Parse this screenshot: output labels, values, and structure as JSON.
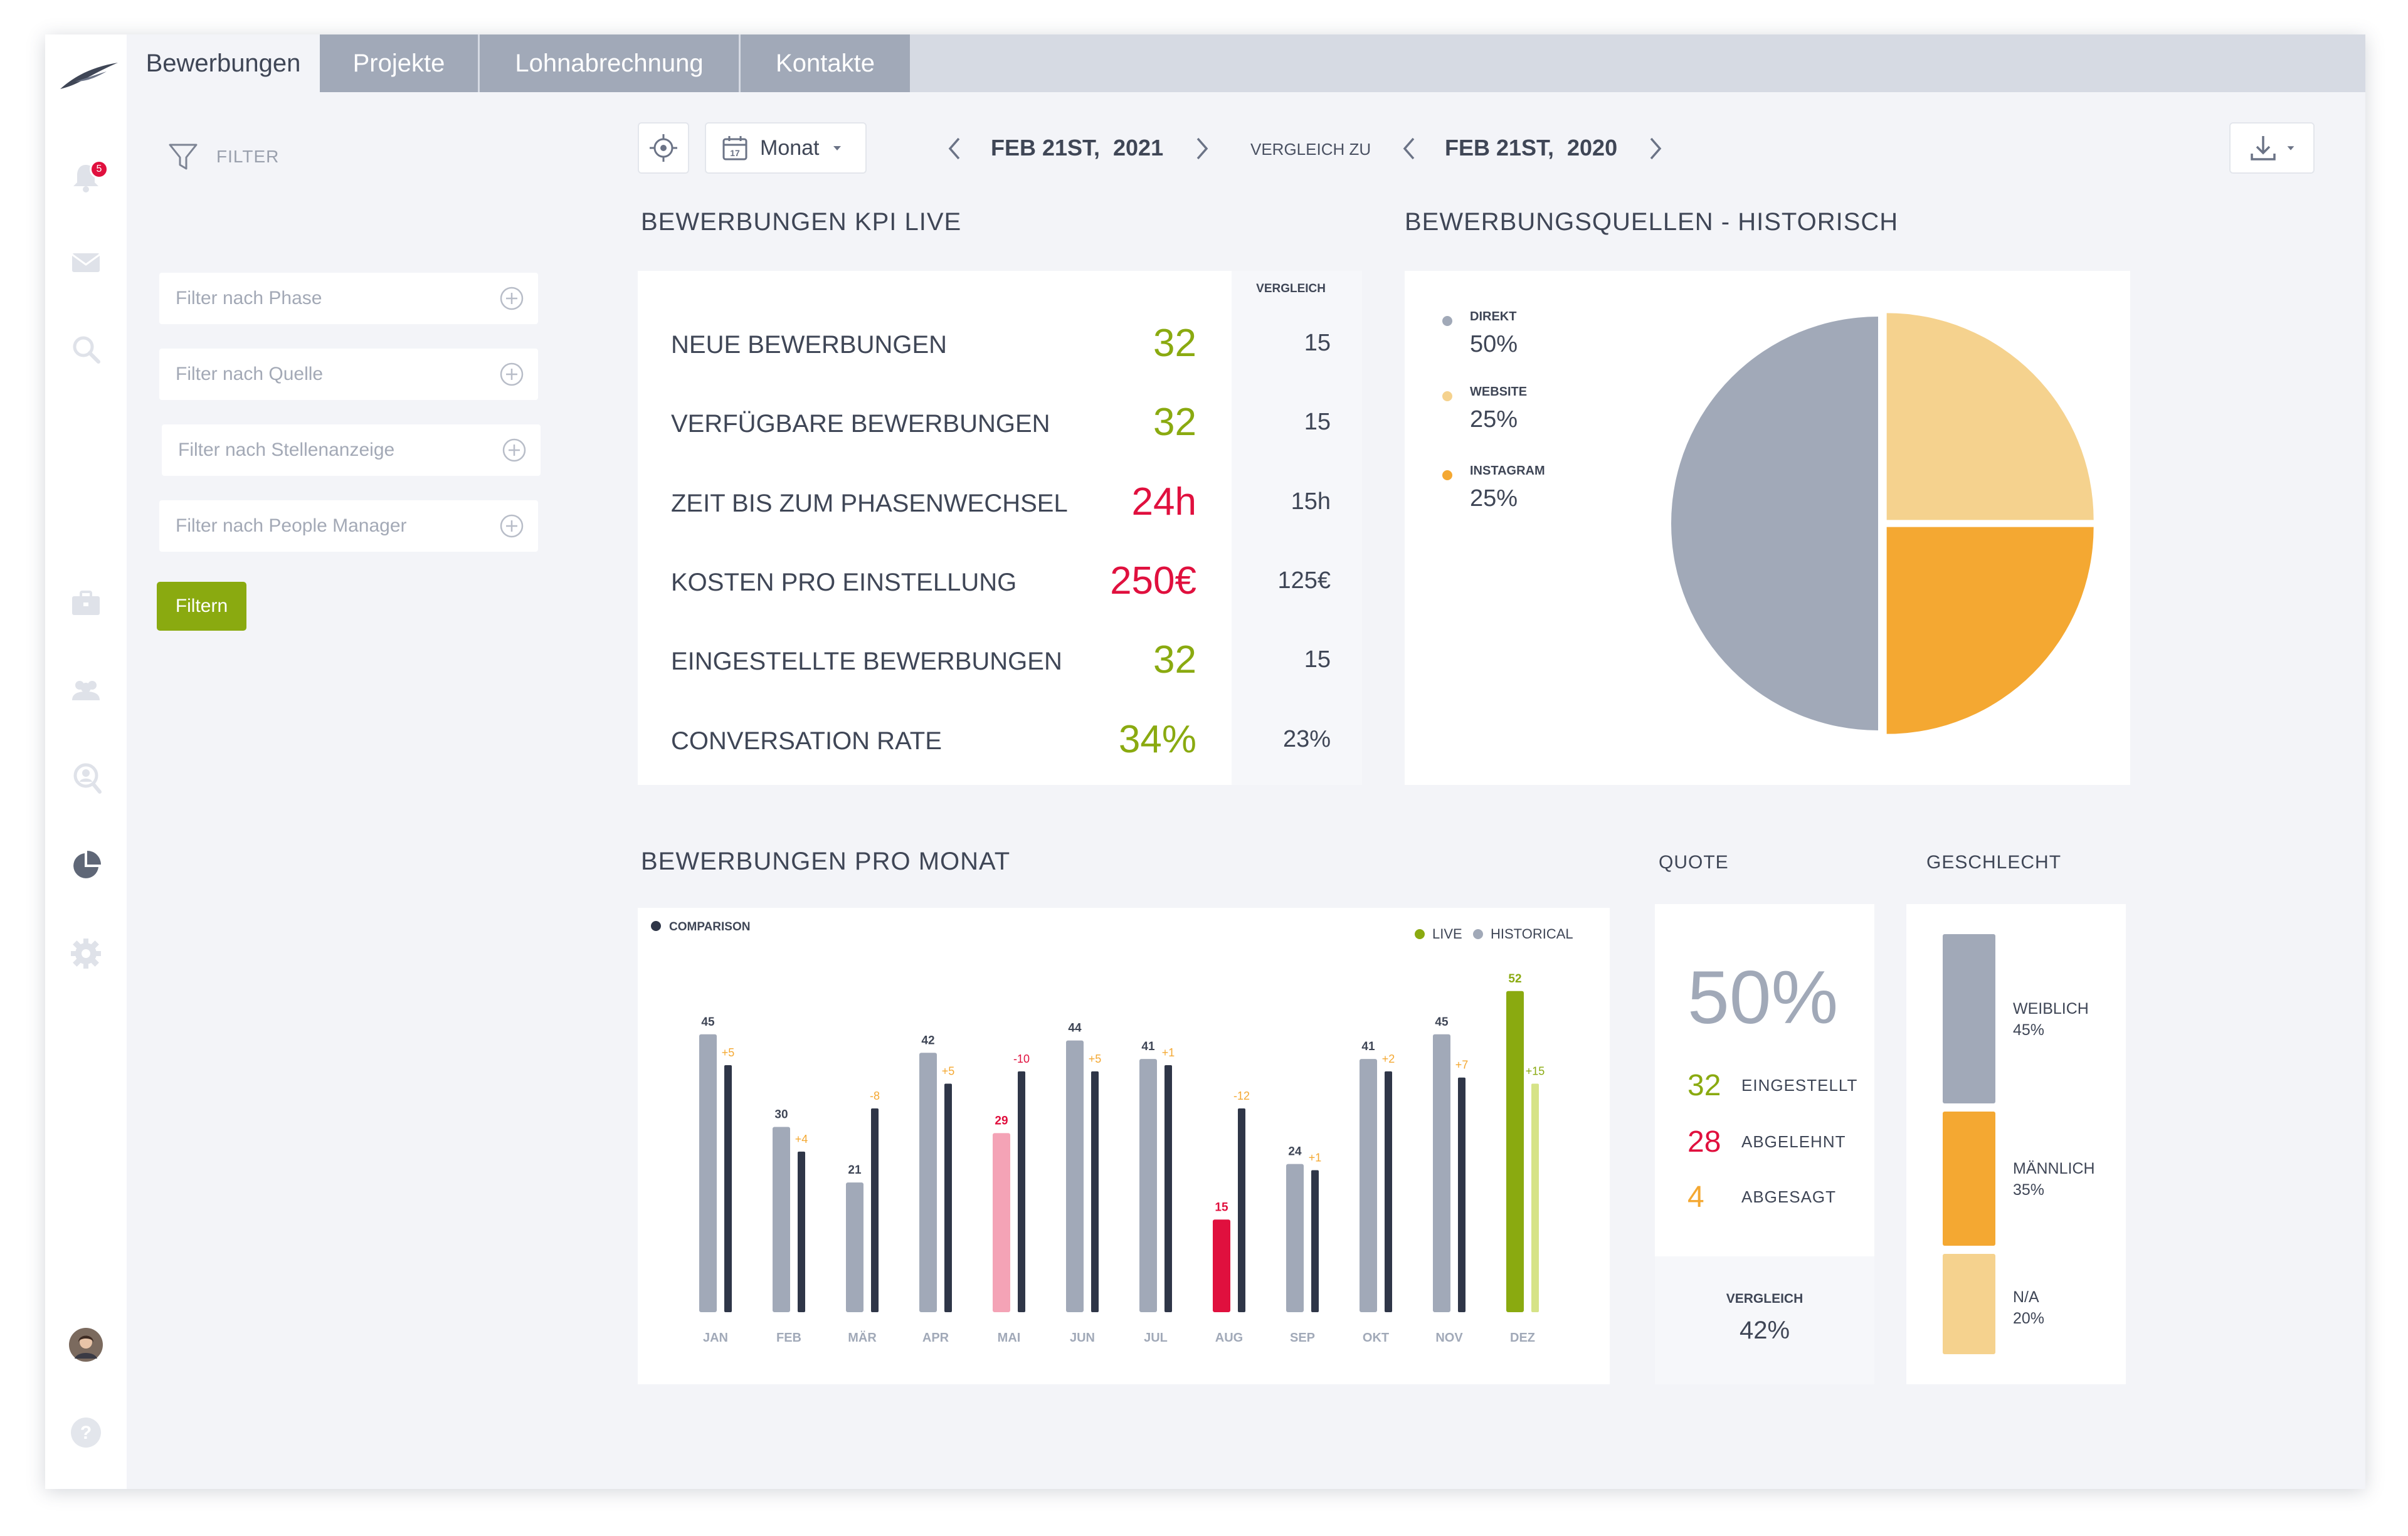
{
  "tabs": [
    {
      "label": "Bewerbungen",
      "active": true
    },
    {
      "label": "Projekte"
    },
    {
      "label": "Lohnabrechnung"
    },
    {
      "label": "Kontakte"
    }
  ],
  "notifications": {
    "count": "5"
  },
  "sidebar_icons": [
    "logo-icon",
    "bell-icon",
    "mail-icon",
    "search-icon",
    "briefcase-icon",
    "team-icon",
    "recruiting-icon",
    "pie-chart-icon",
    "gear-icon",
    "avatar",
    "help-icon"
  ],
  "filter": {
    "title": "FILTER",
    "fields": [
      {
        "placeholder": "Filter nach Phase"
      },
      {
        "placeholder": "Filter nach Quelle"
      },
      {
        "placeholder": "Filter nach Stellenanzeige"
      },
      {
        "placeholder": "Filter nach People Manager"
      }
    ],
    "button": "Filtern"
  },
  "toolbar": {
    "period": "Monat",
    "calendar_day": "17",
    "date_current_prefix": "FEB 21ST,",
    "date_current_year": "2021",
    "compare_label": "VERGLEICH ZU",
    "date_compare_prefix": "FEB 21ST,",
    "date_compare_year": "2020"
  },
  "kpi": {
    "title": "BEWERBUNGEN KPI LIVE",
    "compare_header": "VERGLEICH",
    "rows": [
      {
        "label": "NEUE BEWERBUNGEN",
        "value": "32",
        "compare": "15",
        "status": "good"
      },
      {
        "label": "VERFÜGBARE BEWERBUNGEN",
        "value": "32",
        "compare": "15",
        "status": "good"
      },
      {
        "label": "ZEIT BIS ZUM PHASENWECHSEL",
        "value": "24h",
        "compare": "15h",
        "status": "bad"
      },
      {
        "label": "KOSTEN PRO EINSTELLUNG",
        "value": "250€",
        "compare": "125€",
        "status": "bad"
      },
      {
        "label": "EINGESTELLTE BEWERBUNGEN",
        "value": "32",
        "compare": "15",
        "status": "good"
      },
      {
        "label": "CONVERSATION RATE",
        "value": "34%",
        "compare": "23%",
        "status": "good"
      }
    ]
  },
  "sources": {
    "title": "BEWERBUNGSQUELLEN - HISTORISCH",
    "slices": [
      {
        "name": "DIREKT",
        "value": 50,
        "label": "50%",
        "color": "#a1a9b8"
      },
      {
        "name": "WEBSITE",
        "value": 25,
        "label": "25%",
        "color": "#f5d28e"
      },
      {
        "name": "INSTAGRAM",
        "value": 25,
        "label": "25%",
        "color": "#f4a832"
      }
    ]
  },
  "chart_data": {
    "type": "bar",
    "title": "BEWERBUNGEN PRO MONAT",
    "legend": {
      "comparison": "COMPARISON",
      "live": "LIVE",
      "historical": "HISTORICAL"
    },
    "categories": [
      "JAN",
      "FEB",
      "MÄR",
      "APR",
      "MAI",
      "JUN",
      "JUL",
      "AUG",
      "SEP",
      "OKT",
      "NOV",
      "DEZ"
    ],
    "series": [
      {
        "name": "HISTORICAL",
        "values": [
          45,
          30,
          21,
          42,
          29,
          44,
          41,
          15,
          24,
          41,
          45,
          52
        ]
      },
      {
        "name": "COMPARISON",
        "values": [
          40,
          26,
          33,
          37,
          39,
          39,
          40,
          33,
          23,
          39,
          38,
          37
        ]
      }
    ],
    "deltas": [
      "+5",
      "+4",
      "-8",
      "+5",
      "-10",
      "+5",
      "+1",
      "-12",
      "+1",
      "+2",
      "+7",
      "+15"
    ],
    "ylim": [
      0,
      60
    ],
    "colors": {
      "historical": "#a1a9b8",
      "comparison": "#2f3648",
      "live": "#8aaa10",
      "delta_pos": "#f4a832",
      "delta_neg": "#e0103e",
      "highlight_neg": "#e0103e",
      "highlight_neg_light": "#f4a3b6",
      "highlight_live_light": "#d6e387"
    }
  },
  "quote": {
    "title": "QUOTE",
    "percent": "50%",
    "rows": [
      {
        "num": "32",
        "label": "EINGESTELLT",
        "color": "#8aaa10"
      },
      {
        "num": "28",
        "label": "ABGELEHNT",
        "color": "#e0103e"
      },
      {
        "num": "4",
        "label": "ABGESAGT",
        "color": "#f4a832"
      }
    ],
    "compare_label": "VERGLEICH",
    "compare_value": "42%"
  },
  "gender": {
    "title": "GESCHLECHT",
    "segments": [
      {
        "label": "WEIBLICH",
        "pct": "45%",
        "value": 45,
        "color": "#a1a9b8"
      },
      {
        "label": "MÄNNLICH",
        "pct": "35%",
        "value": 35,
        "color": "#f4a832"
      },
      {
        "label": "N/A",
        "pct": "20%",
        "value": 20,
        "color": "#f5d28e"
      }
    ]
  },
  "colors": {
    "good": "#8aaa10",
    "bad": "#e0103e",
    "accent": "#8aaa10"
  }
}
